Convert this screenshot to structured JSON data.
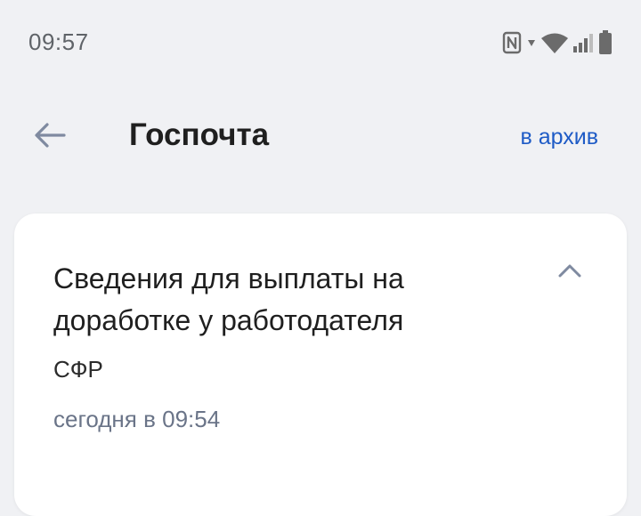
{
  "status_bar": {
    "time": "09:57",
    "icons": [
      "nfc-icon",
      "data-arrow-icon",
      "wifi-icon",
      "signal-icon",
      "battery-icon"
    ]
  },
  "app_bar": {
    "back_icon": "arrow-left-icon",
    "title": "Госпочта",
    "archive_label": "в архив"
  },
  "message_card": {
    "title": "Сведения для выплаты на доработке у работодателя",
    "sender": "СФР",
    "date": "сегодня в 09:54",
    "toggle_icon": "chevron-up-icon"
  },
  "colors": {
    "background": "#f0f1f4",
    "card": "#ffffff",
    "accent_link": "#1e5bc6",
    "secondary_text": "#6a7488",
    "icon_gray": "#7f8aa0"
  }
}
